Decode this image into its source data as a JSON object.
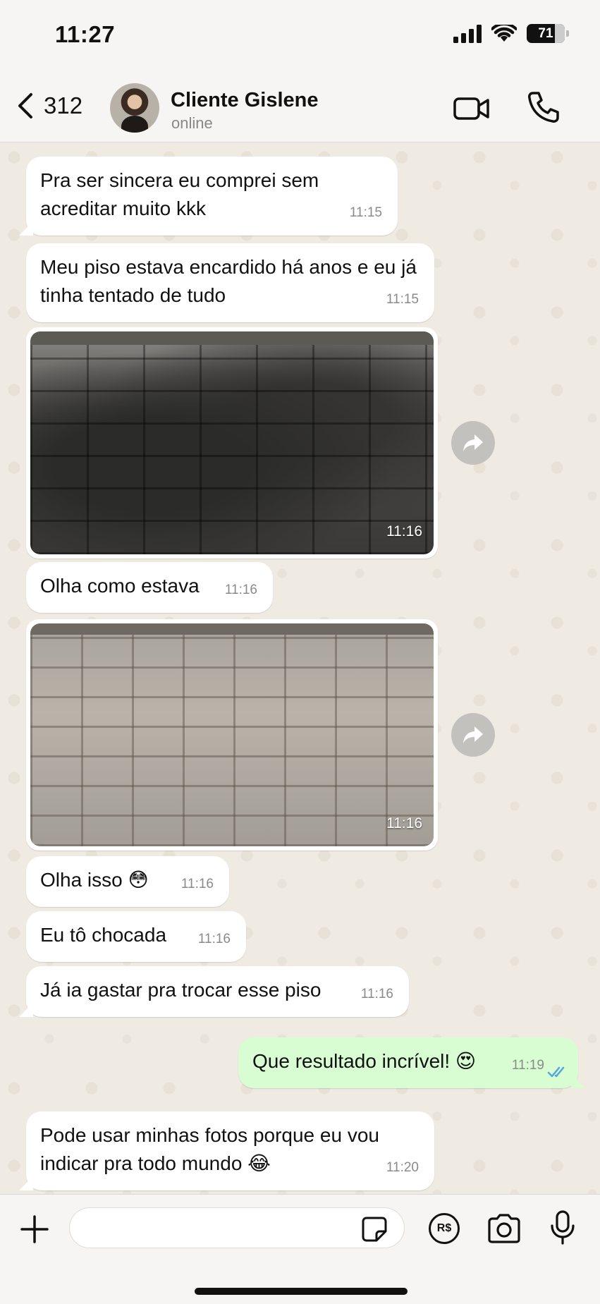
{
  "status_bar": {
    "time": "11:27",
    "battery": "71"
  },
  "header": {
    "back_count": "312",
    "contact_name": "Cliente Gislene",
    "contact_status": "online"
  },
  "messages": [
    {
      "text": "Pra ser sincera eu comprei sem acreditar muito kkk",
      "time": "11:15"
    },
    {
      "text": "Meu piso estava encardido há anos e eu já tinha tentado de tudo",
      "time": "11:15"
    },
    {
      "photo_time": "11:16"
    },
    {
      "text": "Olha como estava",
      "time": "11:16"
    },
    {
      "photo_time": "11:16"
    },
    {
      "text": "Olha isso 😳",
      "time": "11:16"
    },
    {
      "text": "Eu tô chocada",
      "time": "11:16"
    },
    {
      "text": "Já ia gastar pra trocar esse piso",
      "time": "11:16"
    },
    {
      "text": "Que resultado incrível! 😍",
      "time": "11:19"
    },
    {
      "text": "Pode usar minhas fotos porque eu vou indicar pra todo mundo 😂",
      "time": "11:20"
    }
  ],
  "input": {
    "placeholder": "",
    "currency_label": "R$"
  },
  "colors": {
    "outgoing": "#d9fdd3",
    "incoming": "#ffffff",
    "read_ticks": "#53a6e0",
    "wallpaper": "#efeae2"
  }
}
